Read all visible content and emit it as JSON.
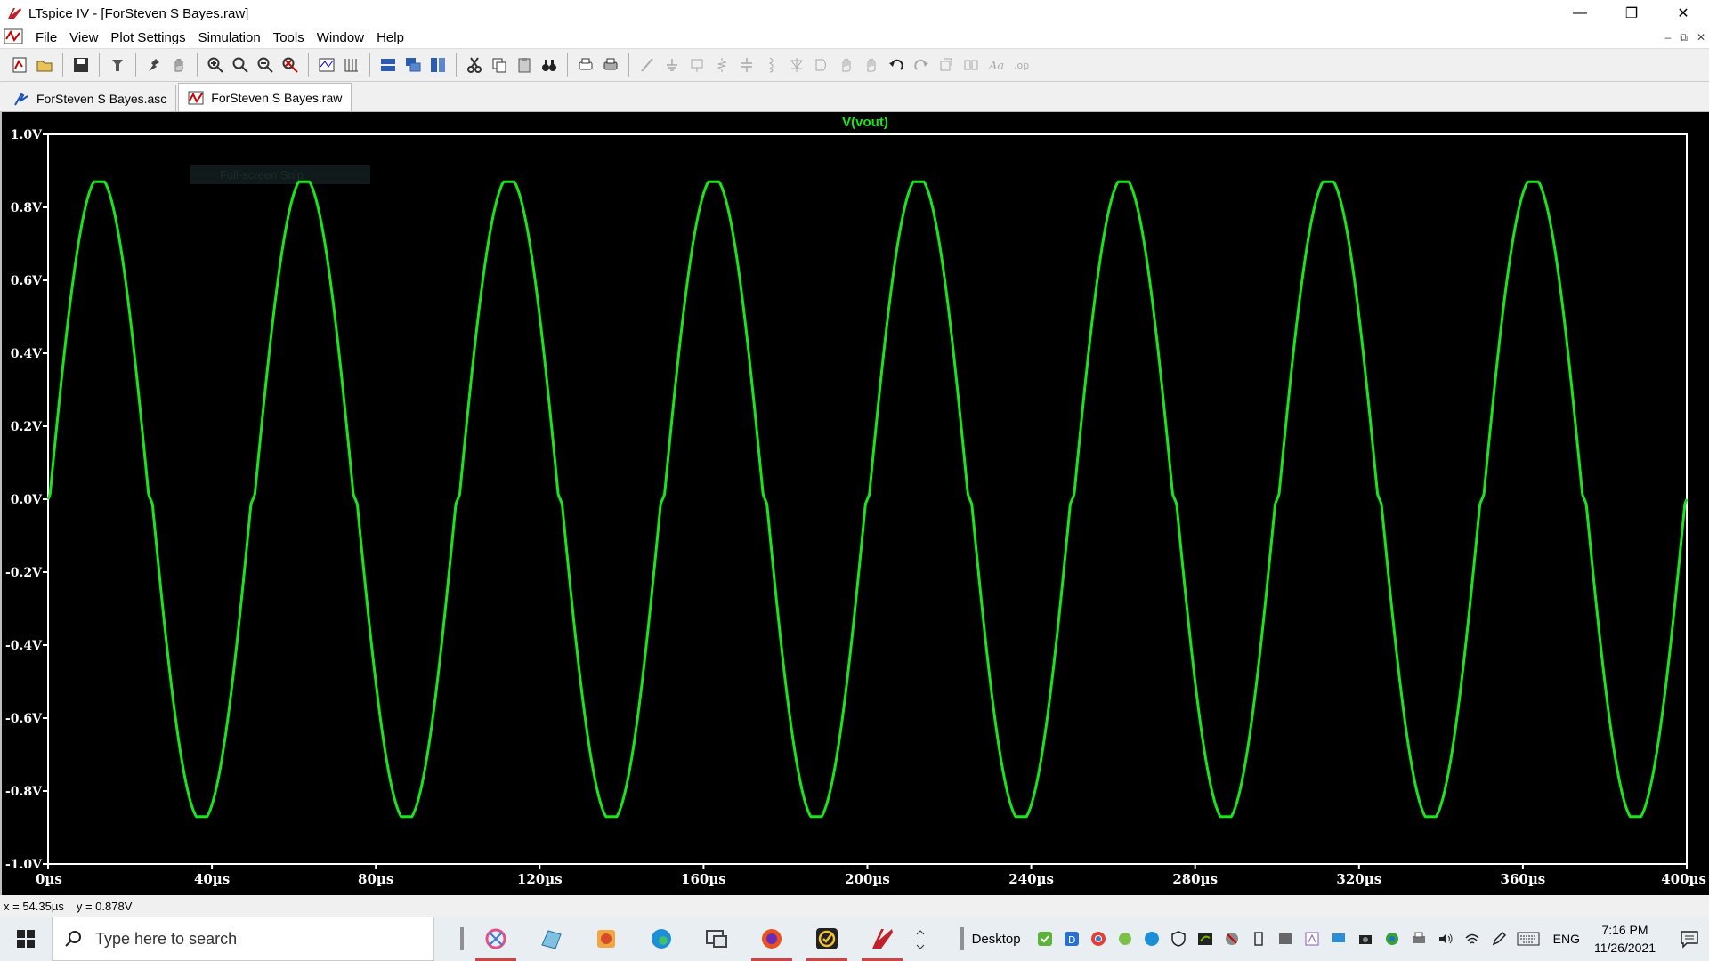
{
  "window": {
    "title": "LTspice IV - [ForSteven S Bayes.raw]",
    "controls": [
      "—",
      "❐",
      "✕"
    ]
  },
  "menu": {
    "items": [
      "File",
      "View",
      "Plot Settings",
      "Simulation",
      "Tools",
      "Window",
      "Help"
    ],
    "mdi_controls": [
      "–",
      "⧉",
      "✕"
    ]
  },
  "tabs": [
    {
      "label": "ForSteven S Bayes.asc",
      "icon": "schematic-icon"
    },
    {
      "label": "ForSteven S Bayes.raw",
      "icon": "waveform-icon"
    }
  ],
  "chart_data": {
    "type": "line",
    "title": "V(vout)",
    "xlabel": "",
    "ylabel": "",
    "xlim": [
      0,
      400
    ],
    "ylim": [
      -1.0,
      1.0
    ],
    "x_unit": "µs",
    "y_unit": "V",
    "x_ticks": [
      "0µs",
      "40µs",
      "80µs",
      "120µs",
      "160µs",
      "200µs",
      "240µs",
      "280µs",
      "320µs",
      "360µs",
      "400µs"
    ],
    "y_ticks": [
      "1.0V",
      "0.8V",
      "0.6V",
      "0.4V",
      "0.2V",
      "0.0V",
      "-0.2V",
      "-0.4V",
      "-0.6V",
      "-0.8V",
      "-1.0V"
    ],
    "series": [
      {
        "name": "V(vout)",
        "color": "#19e619",
        "period_us": 50,
        "amplitude": 0.87,
        "crossover_dead_zone": 0.06,
        "x": [
          0,
          6.25,
          12.5,
          18.75,
          25,
          31.25,
          37.5,
          43.75,
          50
        ],
        "y": [
          0.0,
          0.62,
          0.87,
          0.62,
          -0.04,
          -0.62,
          -0.87,
          -0.62,
          0.0
        ]
      }
    ],
    "grid": false,
    "background": "#000000",
    "axis_color": "#ffffff",
    "faint_overlay_text": "Full-screen Snip"
  },
  "status": {
    "x_readout": "x = 54.35µs",
    "y_readout": "y = 0.878V"
  },
  "taskbar": {
    "search_placeholder": "Type here to search",
    "apps": [
      "snipping-tool-icon",
      "desktop-app-icon",
      "paint-app-icon",
      "edge-icon",
      "remote-desktop-icon",
      "firefox-icon",
      "checkmark-app-icon",
      "ltspice-icon"
    ],
    "desktop_label": "Desktop",
    "language": "ENG",
    "time": "7:16 PM",
    "date": "11/26/2021"
  }
}
